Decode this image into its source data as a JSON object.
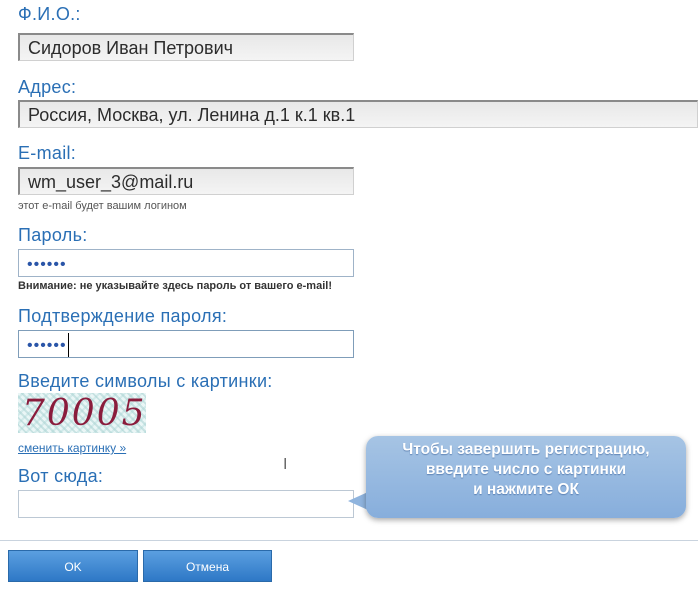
{
  "form": {
    "fio": {
      "label": "Ф.И.О.:",
      "value": "Сидоров Иван Петрович"
    },
    "address": {
      "label": "Адрес:",
      "value": "Россия, Москва, ул. Ленина д.1 к.1 кв.1"
    },
    "email": {
      "label": "E-mail:",
      "value": "wm_user_3@mail.ru",
      "hint": "этот e-mail будет вашим логином"
    },
    "password": {
      "label": "Пароль:",
      "value": "••••••",
      "warning": "Внимание: не указывайте здесь пароль от вашего e-mail!"
    },
    "password_confirm": {
      "label": "Подтверждение пароля:",
      "value": "••••••"
    },
    "captcha": {
      "label": "Введите символы с картинки:",
      "image_text": "70005",
      "change_link": "сменить картинку »"
    },
    "captcha_input": {
      "label": "Вот сюда:",
      "value": ""
    }
  },
  "tooltip": {
    "line1": "Чтобы завершить регистрацию,",
    "line2": "введите число с картинки",
    "line3": "и нажмите ОК"
  },
  "buttons": {
    "ok": "OK",
    "cancel": "Отмена"
  },
  "colors": {
    "label_blue": "#2a6fb5",
    "button_blue": "#2e78c6",
    "tooltip_blue": "#97b9e0",
    "captcha_text": "#8a1c3c"
  }
}
